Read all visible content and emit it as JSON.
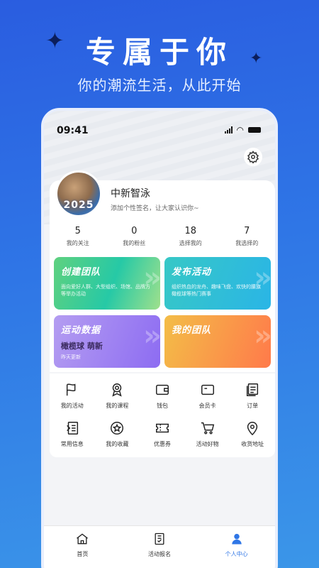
{
  "promo": {
    "headline": "专属于你",
    "subline": "你的潮流生活，从此开始"
  },
  "status_bar": {
    "time": "09:41"
  },
  "profile": {
    "nickname": "中新智泳",
    "signature": "添加个性签名，让大家认识你~",
    "avatar_text": "2025"
  },
  "stats": [
    {
      "value": "5",
      "label": "我的关注"
    },
    {
      "value": "0",
      "label": "我的粉丝"
    },
    {
      "value": "18",
      "label": "选择我的"
    },
    {
      "value": "7",
      "label": "我选择的"
    }
  ],
  "tiles": [
    {
      "title": "创建团队",
      "desc": "面向爱好人群、大型组织、场馆、品牌方等举办活动"
    },
    {
      "title": "发布活动",
      "desc": "组织热血的龙舟、趣味飞盘、欢快的腰旗橄榄球等热门赛事"
    },
    {
      "title": "运动数据",
      "highlight": "橄榄球 萌新",
      "sub": "昨天更新"
    },
    {
      "title": "我的团队"
    }
  ],
  "menu": [
    {
      "label": "我的活动",
      "icon": "flag-icon"
    },
    {
      "label": "我的课程",
      "icon": "medal-icon"
    },
    {
      "label": "钱包",
      "icon": "wallet-icon"
    },
    {
      "label": "会员卡",
      "icon": "card-icon"
    },
    {
      "label": "订单",
      "icon": "order-icon"
    },
    {
      "label": "常用信息",
      "icon": "info-icon"
    },
    {
      "label": "我的收藏",
      "icon": "star-icon"
    },
    {
      "label": "优惠券",
      "icon": "coupon-icon"
    },
    {
      "label": "活动好物",
      "icon": "cart-icon"
    },
    {
      "label": "收货地址",
      "icon": "location-icon"
    }
  ],
  "tabbar": [
    {
      "label": "首页",
      "icon": "home-icon"
    },
    {
      "label": "活动报名",
      "icon": "signup-icon"
    },
    {
      "label": "个人中心",
      "icon": "profile-icon",
      "active": true
    }
  ],
  "colors": {
    "accent": "#2f76e6",
    "background_top": "#2a5de0",
    "background_bottom": "#3b96e8"
  }
}
